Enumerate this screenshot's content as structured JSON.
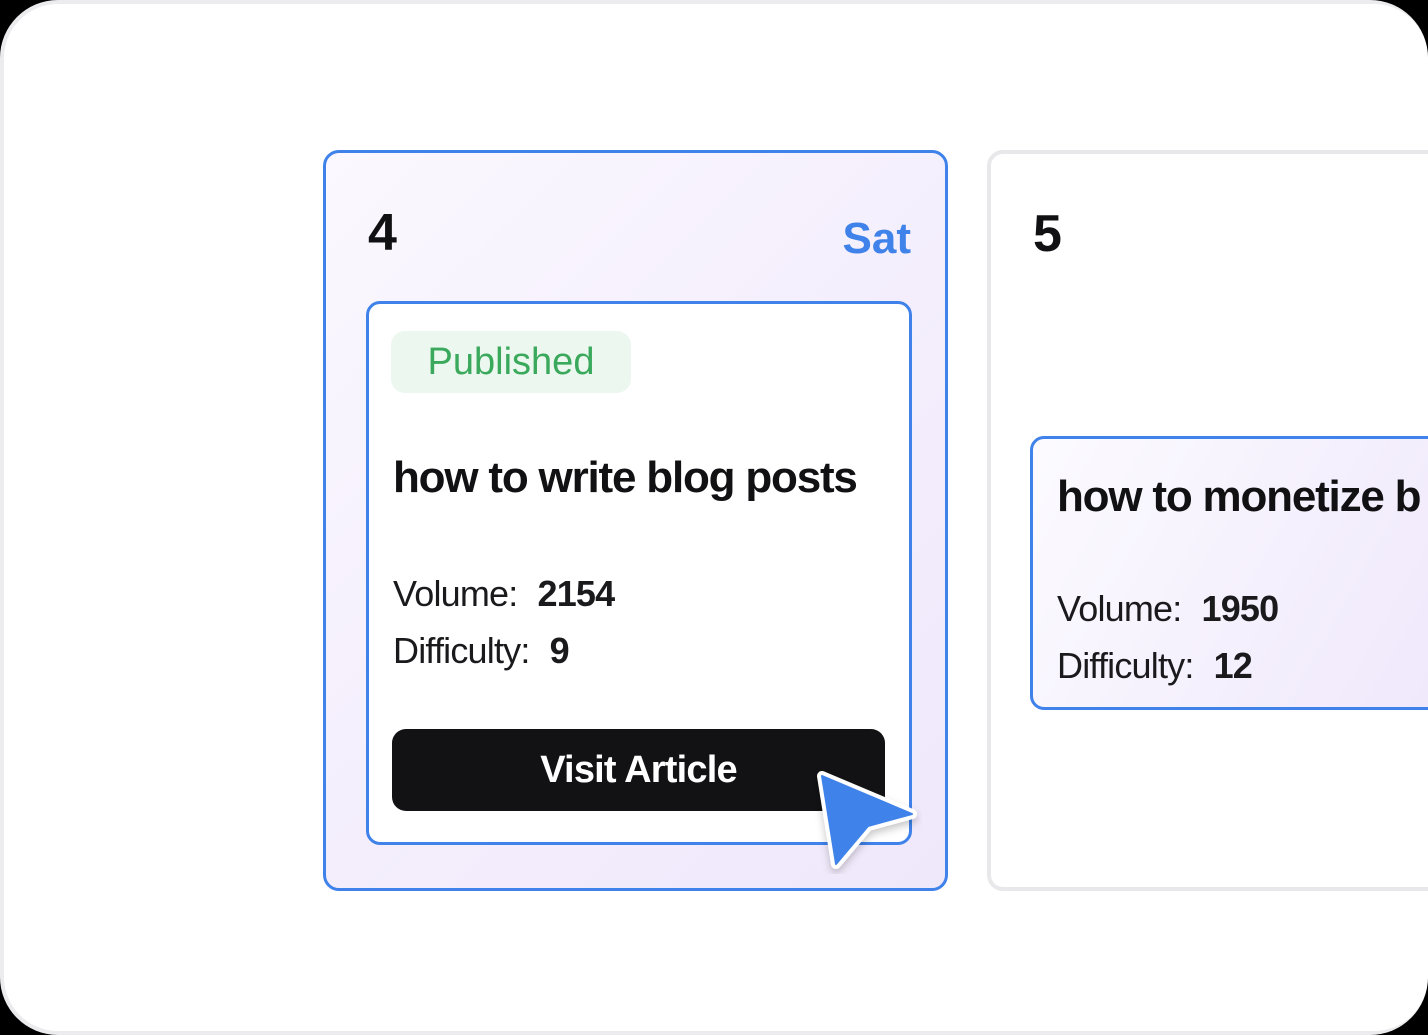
{
  "calendar": {
    "days": [
      {
        "number": "4",
        "weekday": "Sat",
        "article": {
          "status": "Published",
          "title": "how to write blog posts",
          "volume_label": "Volume:",
          "volume": "2154",
          "difficulty_label": "Difficulty:",
          "difficulty": "9",
          "button_label": "Visit Article"
        }
      },
      {
        "number": "5",
        "article": {
          "title": "how to monetize b",
          "volume_label": "Volume:",
          "volume": "1950",
          "difficulty_label": "Difficulty:",
          "difficulty": "12"
        }
      }
    ]
  },
  "colors": {
    "accent": "#3f82ea",
    "published": "#3aa95c",
    "button_bg": "#121214"
  },
  "icons": {
    "cursor": "pointer-cursor-icon"
  }
}
